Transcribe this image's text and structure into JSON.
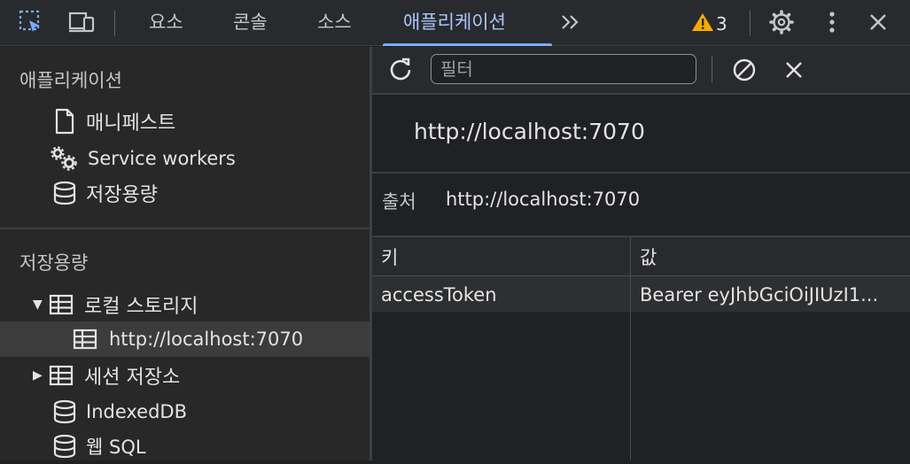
{
  "toolbar": {
    "tabs": [
      {
        "label": "요소"
      },
      {
        "label": "콘솔"
      },
      {
        "label": "소스"
      },
      {
        "label": "애플리케이션"
      }
    ],
    "more_tabs": "»",
    "warning_count": "3",
    "icons": [
      "inspect-element-icon",
      "device-toolbar-icon",
      "warning-icon",
      "settings-gear-icon",
      "more-vertical-icon",
      "close-icon"
    ],
    "accent_color": "#a8c7fa",
    "warning_color": "#f9ab00"
  },
  "sidebar": {
    "application_section": {
      "title": "애플리케이션",
      "items": [
        {
          "label": "매니페스트",
          "icon": "file-icon"
        },
        {
          "label": "Service workers",
          "icon": "gears-icon"
        },
        {
          "label": "저장용량",
          "icon": "database-icon"
        }
      ]
    },
    "storage_section": {
      "title": "저장용량",
      "local_storage": {
        "label": "로컬 스토리지",
        "expanded": true,
        "children": [
          {
            "label": "http://localhost:7070",
            "selected": true
          }
        ]
      },
      "session_storage": {
        "label": "세션 저장소",
        "expanded": false
      },
      "indexeddb": {
        "label": "IndexedDB"
      },
      "websql": {
        "label": "웹 SQL"
      }
    }
  },
  "pane": {
    "filter_placeholder": "필터",
    "origin_header": "http://localhost:7070",
    "origin_label": "출처",
    "origin_value": "http://localhost:7070",
    "table": {
      "columns": [
        "키",
        "값"
      ],
      "rows": [
        {
          "key": "accessToken",
          "value": "Bearer eyJhbGciOiJIUzI1..."
        }
      ]
    }
  }
}
